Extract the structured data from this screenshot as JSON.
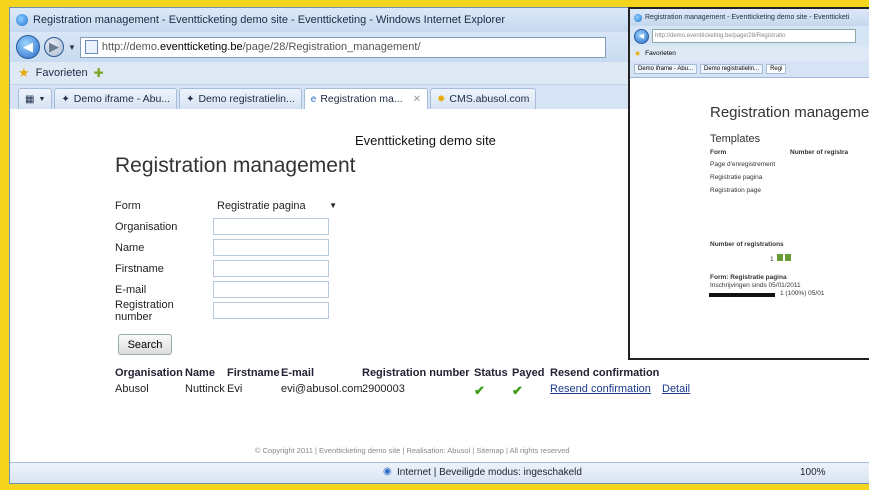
{
  "window": {
    "title": "Registration management - Eventticketing demo site - Eventticketing - Windows Internet Explorer"
  },
  "address": {
    "prefix": "http://demo.",
    "domain": "eventticketing.be",
    "path": "/page/28/Registration_management/"
  },
  "favorites": {
    "label": "Favorieten"
  },
  "tabs": [
    {
      "label": "Demo iframe - Abu..."
    },
    {
      "label": "Demo registratielin..."
    },
    {
      "label": "Registration ma..."
    },
    {
      "label": "CMS.abusol.com"
    }
  ],
  "page": {
    "site_title": "Eventticketing demo site",
    "heading": "Registration management",
    "form": {
      "form_label": "Form",
      "form_value": "Registratie pagina",
      "organisation_label": "Organisation",
      "name_label": "Name",
      "firstname_label": "Firstname",
      "email_label": "E-mail",
      "regnum_label": "Registration number"
    },
    "search_label": "Search",
    "results": {
      "headers": [
        "Organisation",
        "Name",
        "Firstname",
        "E-mail",
        "Registration number",
        "Status",
        "Payed",
        "Resend confirmation"
      ],
      "row": {
        "organisation": "Abusol",
        "name": "Nuttinck",
        "firstname": "Evi",
        "email": "evi@abusol.com",
        "regnum": "2900003",
        "resend": "Resend confirmation",
        "detail": "Detail"
      }
    },
    "copyright": "© Copyright 2011 | Eventticketing demo site | Realisation: Abusol | Sitemap | All rights reserved"
  },
  "status": {
    "text": "Internet | Beveiligde modus: ingeschakeld",
    "zoom": "100%"
  },
  "popup": {
    "title": "Registration management - Eventticketing demo site - Eventticketi",
    "address": "http://demo.eventticketing.be/page/28/Registratio",
    "favorites": "Favorieten",
    "tab1": "Demo iframe - Abu...",
    "tab2": "Demo registratielin...",
    "tab3": "Regi",
    "heading": "Registration manageme",
    "templates": "Templates",
    "col_form": "Form",
    "col_num": "Number of registra",
    "t1": "Page d'enregistrement",
    "t2": "Registratie pagina",
    "t3": "Registration page",
    "num_label": "Number of registrations",
    "num_value": "1",
    "form_info": "Form: Registratie pagina",
    "since": "Inschrijvingen sinds 05/01/2011",
    "bar_text": "1 (100%) 05/01"
  }
}
